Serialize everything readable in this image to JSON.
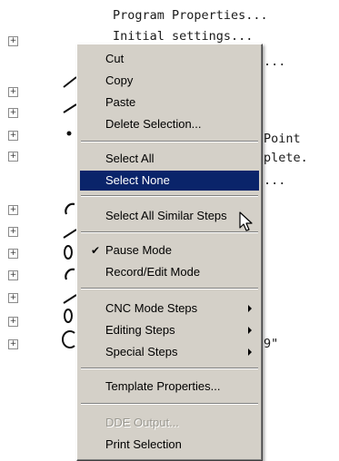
{
  "background_lines": [
    "Program Properties...",
    "Initial settings...",
    "...",
    "Point",
    "plete.",
    "...",
    "9\""
  ],
  "menu": {
    "items": [
      {
        "label": "Cut"
      },
      {
        "label": "Copy"
      },
      {
        "label": "Paste"
      },
      {
        "label": "Delete Selection..."
      },
      {
        "label": "Select All"
      },
      {
        "label": "Select None",
        "state": "selected"
      },
      {
        "label": "Select All Similar Steps"
      },
      {
        "label": "Pause Mode",
        "checked": true
      },
      {
        "label": "Record/Edit Mode"
      },
      {
        "label": "CNC Mode Steps",
        "submenu": true
      },
      {
        "label": "Editing Steps",
        "submenu": true
      },
      {
        "label": "Special Steps",
        "submenu": true
      },
      {
        "label": "Template Properties..."
      },
      {
        "label": "DDE Output...",
        "disabled": true
      },
      {
        "label": "Print Selection"
      }
    ]
  },
  "icons": {
    "expander": "plus-expander-icon",
    "check": "checkmark-icon",
    "submenu": "submenu-arrow-icon",
    "cursor": "mouse-pointer-icon"
  },
  "colors": {
    "menu_background": "#d4d0c8",
    "selection": "#0a246a"
  }
}
